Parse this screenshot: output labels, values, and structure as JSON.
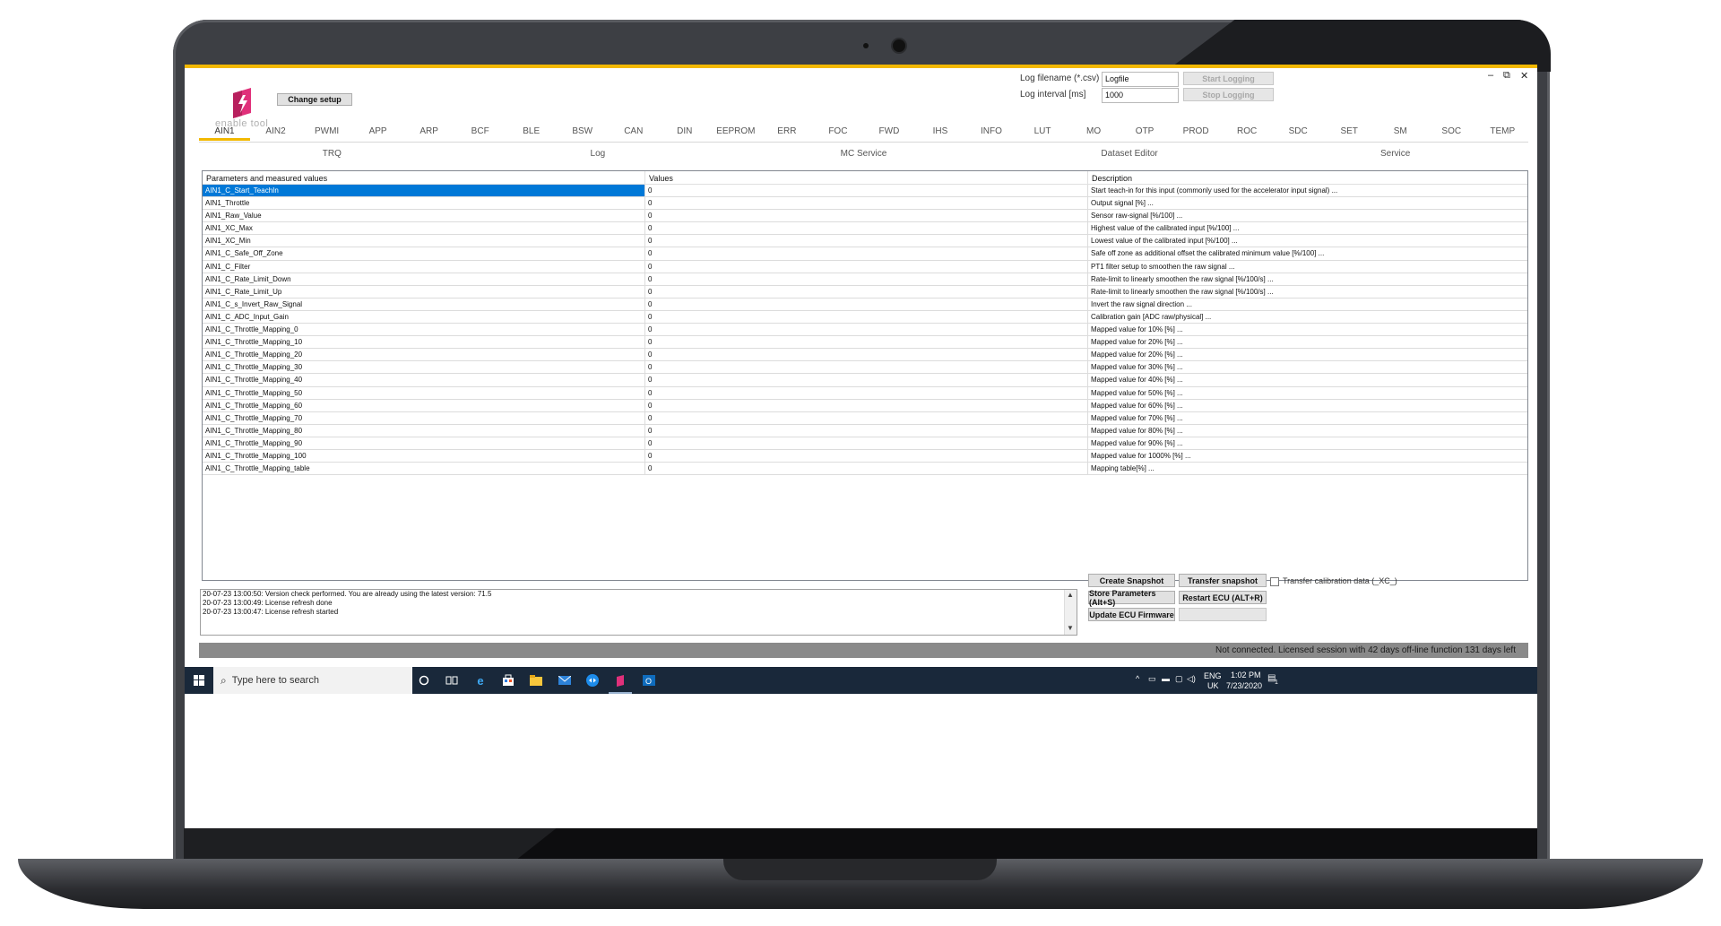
{
  "app": {
    "logo_text": "enable tool",
    "change_setup_label": "Change setup",
    "window_controls": {
      "minimize": "–",
      "restore": "⧉",
      "close": "✕"
    }
  },
  "logging": {
    "filename_label": "Log filename (*.csv)",
    "filename_value": "Logfile",
    "interval_label": "Log interval [ms]",
    "interval_value": "1000",
    "start_label": "Start Logging",
    "stop_label": "Stop Logging"
  },
  "tabs": [
    "AIN1",
    "AIN2",
    "PWMI",
    "APP",
    "ARP",
    "BCF",
    "BLE",
    "BSW",
    "CAN",
    "DIN",
    "EEPROM",
    "ERR",
    "FOC",
    "FWD",
    "IHS",
    "INFO",
    "LUT",
    "MO",
    "OTP",
    "PROD",
    "ROC",
    "SDC",
    "SET",
    "SM",
    "SOC",
    "TEMP"
  ],
  "active_tab": "AIN1",
  "subtabs": [
    "TRQ",
    "Log",
    "MC Service",
    "Dataset Editor",
    "Service"
  ],
  "grid": {
    "headers": [
      "Parameters and measured values",
      "Values",
      "Description"
    ],
    "rows": [
      [
        "AIN1_C_Start_TeachIn",
        "0",
        "Start teach-in for this input (commonly used for the accelerator input signal) ..."
      ],
      [
        "AIN1_Throttle",
        "0",
        "Output signal  [%] ..."
      ],
      [
        "AIN1_Raw_Value",
        "0",
        "Sensor raw-signal [%/100] ..."
      ],
      [
        "AIN1_XC_Max",
        "0",
        "Highest value of the calibrated input [%/100] ..."
      ],
      [
        "AIN1_XC_Min",
        "0",
        "Lowest value of the calibrated input [%/100] ..."
      ],
      [
        "AIN1_C_Safe_Off_Zone",
        "0",
        "Safe off zone as additional offset the calibrated minimum value [%/100] ..."
      ],
      [
        "AIN1_C_Filter",
        "0",
        "PT1 filter setup to smoothen the raw signal ..."
      ],
      [
        "AIN1_C_Rate_Limit_Down",
        "0",
        "Rate-limit to linearly smoothen the raw signal [%/100/s] ..."
      ],
      [
        "AIN1_C_Rate_Limit_Up",
        "0",
        "Rate-limit to linearly smoothen the raw signal [%/100/s] ..."
      ],
      [
        "AIN1_C_s_Invert_Raw_Signal",
        "0",
        "Invert the raw signal direction ..."
      ],
      [
        "AIN1_C_ADC_Input_Gain",
        "0",
        "Calibration gain [ADC raw/physical] ..."
      ],
      [
        "AIN1_C_Throttle_Mapping_0",
        "0",
        "Mapped value for 10% [%] ..."
      ],
      [
        "AIN1_C_Throttle_Mapping_10",
        "0",
        "Mapped value for 20% [%] ..."
      ],
      [
        "AIN1_C_Throttle_Mapping_20",
        "0",
        "Mapped value for 20% [%] ..."
      ],
      [
        "AIN1_C_Throttle_Mapping_30",
        "0",
        "Mapped value for 30% [%] ..."
      ],
      [
        "AIN1_C_Throttle_Mapping_40",
        "0",
        "Mapped value for 40% [%] ..."
      ],
      [
        "AIN1_C_Throttle_Mapping_50",
        "0",
        "Mapped value for 50% [%] ..."
      ],
      [
        "AIN1_C_Throttle_Mapping_60",
        "0",
        "Mapped value for 60% [%] ..."
      ],
      [
        "AIN1_C_Throttle_Mapping_70",
        "0",
        "Mapped value for 70% [%] ..."
      ],
      [
        "AIN1_C_Throttle_Mapping_80",
        "0",
        "Mapped value for 80% [%] ..."
      ],
      [
        "AIN1_C_Throttle_Mapping_90",
        "0",
        "Mapped value for 90% [%] ..."
      ],
      [
        "AIN1_C_Throttle_Mapping_100",
        "0",
        "Mapped value for 1000% [%] ..."
      ],
      [
        "AIN1_C_Throttle_Mapping_table",
        "0",
        "Mapping table[%] ..."
      ]
    ]
  },
  "log_lines": [
    "20-07-23 13:00:50: Version check performed. You are already using the latest version: 71.5",
    "20-07-23 13:00:49: License refresh done",
    "20-07-23 13:00:47: License refresh started"
  ],
  "actions": {
    "create_snapshot": "Create Snapshot",
    "transfer_snapshot": "Transfer snapshot",
    "store_parameters": "Store Parameters (Alt+S)",
    "restart_ecu": "Restart ECU (ALT+R)",
    "update_firmware": "Update ECU Firmware",
    "transfer_calibration": "Transfer calibration data (_XC_)"
  },
  "status": "Not connected.  Licensed session with 42 days off-line function 131 days left",
  "taskbar": {
    "search_placeholder": "Type here to search",
    "lang_top": "ENG",
    "lang_bottom": "UK",
    "time": "1:02 PM",
    "date": "7/23/2020",
    "notification_count": "1"
  },
  "colors": {
    "accent": "#f2b800",
    "selection": "#0078d7",
    "taskbar": "#19283a",
    "logo": "#e0307a"
  }
}
